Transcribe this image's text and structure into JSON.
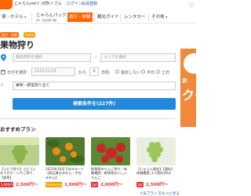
{
  "header": {
    "utility": [
      "じゃらんnetトップ",
      "ゲストさん",
      "ログイン",
      "会員登録"
    ],
    "nav": [
      {
        "label": "宿・ホテル",
        "sub": ""
      },
      {
        "label": "じゃらんパック",
        "sub": "(JR・航空券+宿)"
      },
      {
        "label": "遊び・体験",
        "sub": "",
        "active": true
      },
      {
        "label": "観光ガイド",
        "sub": ""
      },
      {
        "label": "レンタカー",
        "sub": ""
      },
      {
        "label": "その他",
        "sub": ""
      }
    ]
  },
  "breadcrumb_chips": [
    {
      "label": "遊び・体験",
      "color": "#ff6600"
    },
    {
      "label": "Ponta",
      "color": "#f5a000"
    }
  ],
  "page_title": "果物狩り",
  "form": {
    "area_placeholder": "都道府県を選択",
    "area_sub_placeholder": "エリアを選択",
    "date_label": "日付を選択",
    "date_value": "2025/11/19",
    "date_to": "から",
    "duration_value": "1",
    "duration_unit": "日間",
    "radio1": "指定しない",
    "radio2": "平日",
    "radio3": "土日",
    "category_value": "果物・野菜狩り全て"
  },
  "search_button": "検索条件を(227件)",
  "section_title": "おすすめプラン",
  "cards": [
    {
      "text": "【ぶどう狩り】ぶどうにおでかけ・いちご狩り【群馬】",
      "badge": "1,900円",
      "price": "2,500円〜"
    },
    {
      "text": "2025年10月下旬スタート【高品質なみかん・中生みかん】",
      "badge": "Pontaのみ",
      "price": "1,000円〜"
    },
    {
      "text": "群馬県のりんご狩り・体験農園・群馬県おいしいりんご",
      "badge": "1pt",
      "price": "2,000円〜"
    },
    {
      "text": "【じゃらん限定】【通年】体験農園 より園内30分",
      "badge": "1pt",
      "price": "2,500円〜"
    }
  ],
  "more_link": "人気プラン をもっと見る",
  "ad": {
    "line1": "お",
    "line2": "クー"
  }
}
